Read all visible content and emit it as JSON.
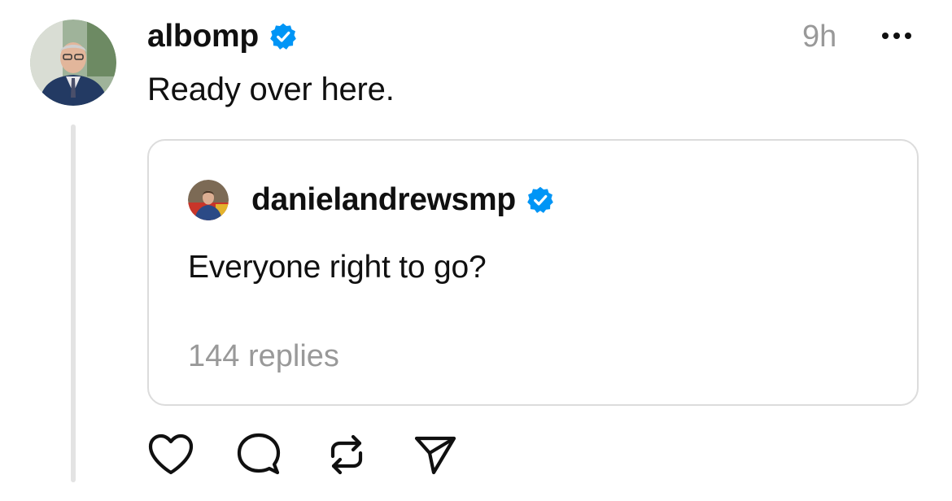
{
  "post": {
    "author": {
      "username": "albomp",
      "verified": true,
      "avatar_icon": "profile-photo"
    },
    "timestamp": "9h",
    "more_icon": "more-horizontal-icon",
    "text": "Ready over here.",
    "quoted_post": {
      "author": {
        "username": "danielandrewsmp",
        "verified": true,
        "avatar_icon": "profile-photo"
      },
      "text": "Everyone right to go?",
      "replies_label": "144 replies"
    },
    "actions": [
      {
        "name": "like",
        "icon": "heart-icon"
      },
      {
        "name": "reply",
        "icon": "comment-icon"
      },
      {
        "name": "repost",
        "icon": "repost-icon"
      },
      {
        "name": "share",
        "icon": "send-icon"
      }
    ]
  },
  "colors": {
    "verified": "#0095f6",
    "text": "#101010",
    "muted": "#999999",
    "border": "#dcdcdc",
    "thread_line": "#e3e3e3"
  }
}
